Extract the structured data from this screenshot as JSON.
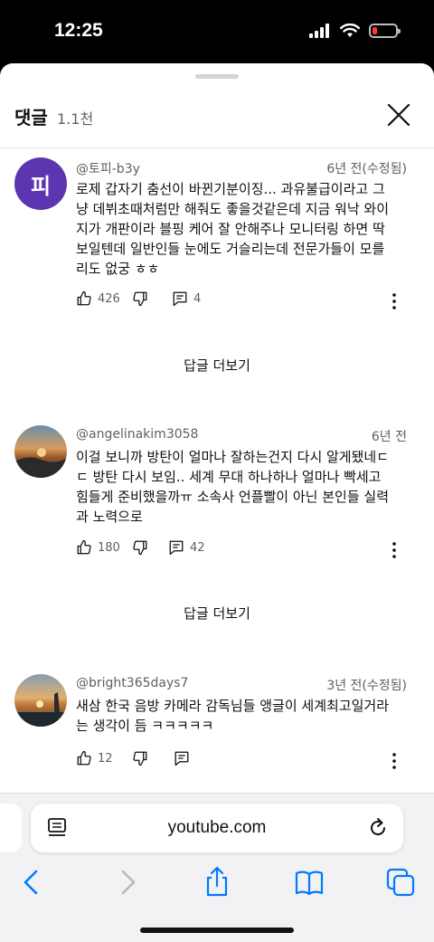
{
  "status_bar": {
    "time": "12:25"
  },
  "header": {
    "title": "댓글",
    "count": "1.1천"
  },
  "comments": [
    {
      "avatar_letter": "피",
      "author": "@토피-b3y",
      "time": "6년 전(수정됨)",
      "lines": [
        "로제 갑자기 춤선이 바뀐기분이징... 과유불급이라고 그",
        "냥 데뷔초때처럼만 해줘도 좋을것같은데 지금 워낙 와이",
        "지가 개판이라 블핑 케어 잘 안해주나 모니터링 하면 딱",
        "보일텐데 일반인들 눈에도 거슬리는데 전문가들이 모를",
        "리도 없궁 ㅎㅎ"
      ],
      "likes": "426",
      "replies": "4",
      "more_replies": "답글 더보기"
    },
    {
      "author": "@angelinakim3058",
      "time": "6년 전",
      "lines": [
        "이걸 보니까 방탄이 얼마나 잘하는건지 다시 알게됐네ㄷ",
        "ㄷ  방탄 다시 보임.. 세계 무대 하나하나 얼마나 빡세고",
        "힘들게 준비했을까ㅠ 소속사 언플빨이 아닌 본인들 실력",
        "과 노력으로"
      ],
      "likes": "180",
      "replies": "42",
      "more_replies": "답글 더보기"
    },
    {
      "author": "@bright365days7",
      "time": "3년 전(수정됨)",
      "lines": [
        "새삼 한국 음방 카메라 감독님들 앵글이 세계최고일거라",
        "는 생각이 듬 ㅋㅋㅋㅋㅋ"
      ],
      "likes": "12"
    }
  ],
  "browser": {
    "url": "youtube.com"
  },
  "icons": [
    "like-icon",
    "dislike-icon",
    "reply-icon",
    "more-vert-icon",
    "close-icon",
    "back-icon",
    "forward-icon",
    "share-icon",
    "bookmarks-icon",
    "tabs-icon",
    "reader-icon",
    "reload-icon"
  ],
  "colors": {
    "accent": "#007aff",
    "avatar_bg": "#5e35b1",
    "battery_low": "#ff3b30"
  }
}
